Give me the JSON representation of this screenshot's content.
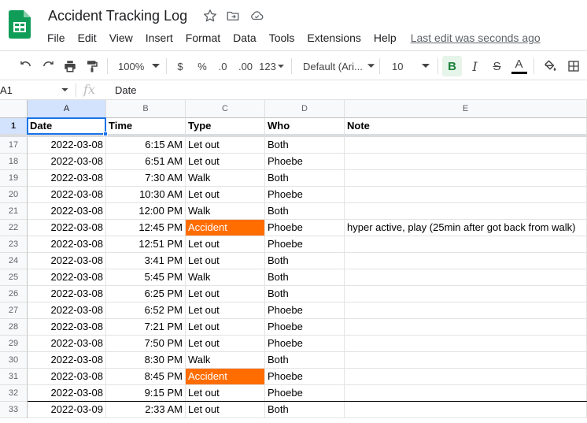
{
  "doc": {
    "title": "Accident Tracking Log",
    "last_edit": "Last edit was seconds ago"
  },
  "menu": [
    "File",
    "Edit",
    "View",
    "Insert",
    "Format",
    "Data",
    "Tools",
    "Extensions",
    "Help"
  ],
  "toolbar": {
    "zoom": "100%",
    "currency": "$",
    "percent": "%",
    "decrease_decimal": ".0",
    "increase_decimal": ".00",
    "more_formats": "123",
    "font": "Default (Ari...",
    "font_size": "10",
    "bold": "B",
    "italic": "I",
    "strikethrough": "S",
    "text_color": "A"
  },
  "formula_bar": {
    "cell_ref": "A1",
    "fx": "fx",
    "content": "Date"
  },
  "columns": [
    "A",
    "B",
    "C",
    "D",
    "E"
  ],
  "header_row": {
    "row_number": "1",
    "cells": [
      "Date",
      "Time",
      "Type",
      "Who",
      "Note"
    ]
  },
  "rows": [
    {
      "n": "17",
      "date": "2022-03-08",
      "time": "6:15 AM",
      "type": "Let out",
      "who": "Both",
      "note": ""
    },
    {
      "n": "18",
      "date": "2022-03-08",
      "time": "6:51 AM",
      "type": "Let out",
      "who": "Phoebe",
      "note": ""
    },
    {
      "n": "19",
      "date": "2022-03-08",
      "time": "7:30 AM",
      "type": "Walk",
      "who": "Both",
      "note": ""
    },
    {
      "n": "20",
      "date": "2022-03-08",
      "time": "10:30 AM",
      "type": "Let out",
      "who": "Phoebe",
      "note": ""
    },
    {
      "n": "21",
      "date": "2022-03-08",
      "time": "12:00 PM",
      "type": "Walk",
      "who": "Both",
      "note": ""
    },
    {
      "n": "22",
      "date": "2022-03-08",
      "time": "12:45 PM",
      "type": "Accident",
      "who": "Phoebe",
      "note": "hyper active, play (25min after got back from walk)"
    },
    {
      "n": "23",
      "date": "2022-03-08",
      "time": "12:51 PM",
      "type": "Let out",
      "who": "Phoebe",
      "note": ""
    },
    {
      "n": "24",
      "date": "2022-03-08",
      "time": "3:41 PM",
      "type": "Let out",
      "who": "Both",
      "note": ""
    },
    {
      "n": "25",
      "date": "2022-03-08",
      "time": "5:45 PM",
      "type": "Walk",
      "who": "Both",
      "note": ""
    },
    {
      "n": "26",
      "date": "2022-03-08",
      "time": "6:25 PM",
      "type": "Let out",
      "who": "Both",
      "note": ""
    },
    {
      "n": "27",
      "date": "2022-03-08",
      "time": "6:52 PM",
      "type": "Let out",
      "who": "Phoebe",
      "note": ""
    },
    {
      "n": "28",
      "date": "2022-03-08",
      "time": "7:21 PM",
      "type": "Let out",
      "who": "Phoebe",
      "note": ""
    },
    {
      "n": "29",
      "date": "2022-03-08",
      "time": "7:50 PM",
      "type": "Let out",
      "who": "Phoebe",
      "note": ""
    },
    {
      "n": "30",
      "date": "2022-03-08",
      "time": "8:30 PM",
      "type": "Walk",
      "who": "Both",
      "note": ""
    },
    {
      "n": "31",
      "date": "2022-03-08",
      "time": "8:45 PM",
      "type": "Accident",
      "who": "Phoebe",
      "note": ""
    },
    {
      "n": "32",
      "date": "2022-03-08",
      "time": "9:15 PM",
      "type": "Let out",
      "who": "Phoebe",
      "note": ""
    },
    {
      "n": "33",
      "date": "2022-03-09",
      "time": "2:33 AM",
      "type": "Let out",
      "who": "Both",
      "note": ""
    }
  ],
  "colors": {
    "accident_fill": "#ff6d01",
    "sheets_green": "#188038",
    "selection_blue": "#1a73e8"
  }
}
